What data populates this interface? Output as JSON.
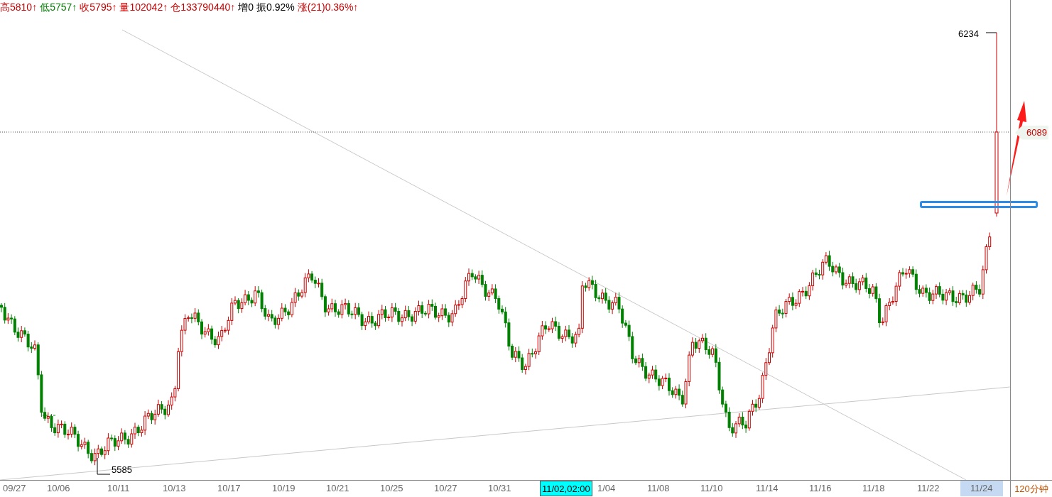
{
  "header": [
    {
      "text": "高5810↑",
      "color": "#cc0000"
    },
    {
      "text": "低5757↑",
      "color": "#008000"
    },
    {
      "text": "收5795↑",
      "color": "#cc0000"
    },
    {
      "text": "量102042↑",
      "color": "#cc0000"
    },
    {
      "text": "仓133790440↑",
      "color": "#cc0000"
    },
    {
      "text": "增0",
      "color": "#000000"
    },
    {
      "text": "振0.92%",
      "color": "#000000"
    },
    {
      "text": "涨(21)0.36%↑",
      "color": "#cc0000"
    }
  ],
  "chart": {
    "high_label": "6234",
    "low_label": "5585",
    "price_tag": "6089",
    "period": "120分钟",
    "cursor_time": "11/02,02:00",
    "x_labels": [
      {
        "text": "09/27",
        "selected": false
      },
      {
        "text": "10/06",
        "selected": false
      },
      {
        "text": "10/11",
        "selected": false
      },
      {
        "text": "10/13",
        "selected": false
      },
      {
        "text": "10/17",
        "selected": false
      },
      {
        "text": "10/19",
        "selected": false
      },
      {
        "text": "10/21",
        "selected": false
      },
      {
        "text": "10/25",
        "selected": false
      },
      {
        "text": "10/27",
        "selected": false
      },
      {
        "text": "10/31",
        "selected": false
      },
      {
        "text": "1/04",
        "selected": false
      },
      {
        "text": "11/08",
        "selected": false
      },
      {
        "text": "11/10",
        "selected": false
      },
      {
        "text": "11/14",
        "selected": false
      },
      {
        "text": "11/16",
        "selected": false
      },
      {
        "text": "11/18",
        "selected": false
      },
      {
        "text": "11/22",
        "selected": false
      },
      {
        "text": "11/24",
        "selected": true
      }
    ]
  }
}
